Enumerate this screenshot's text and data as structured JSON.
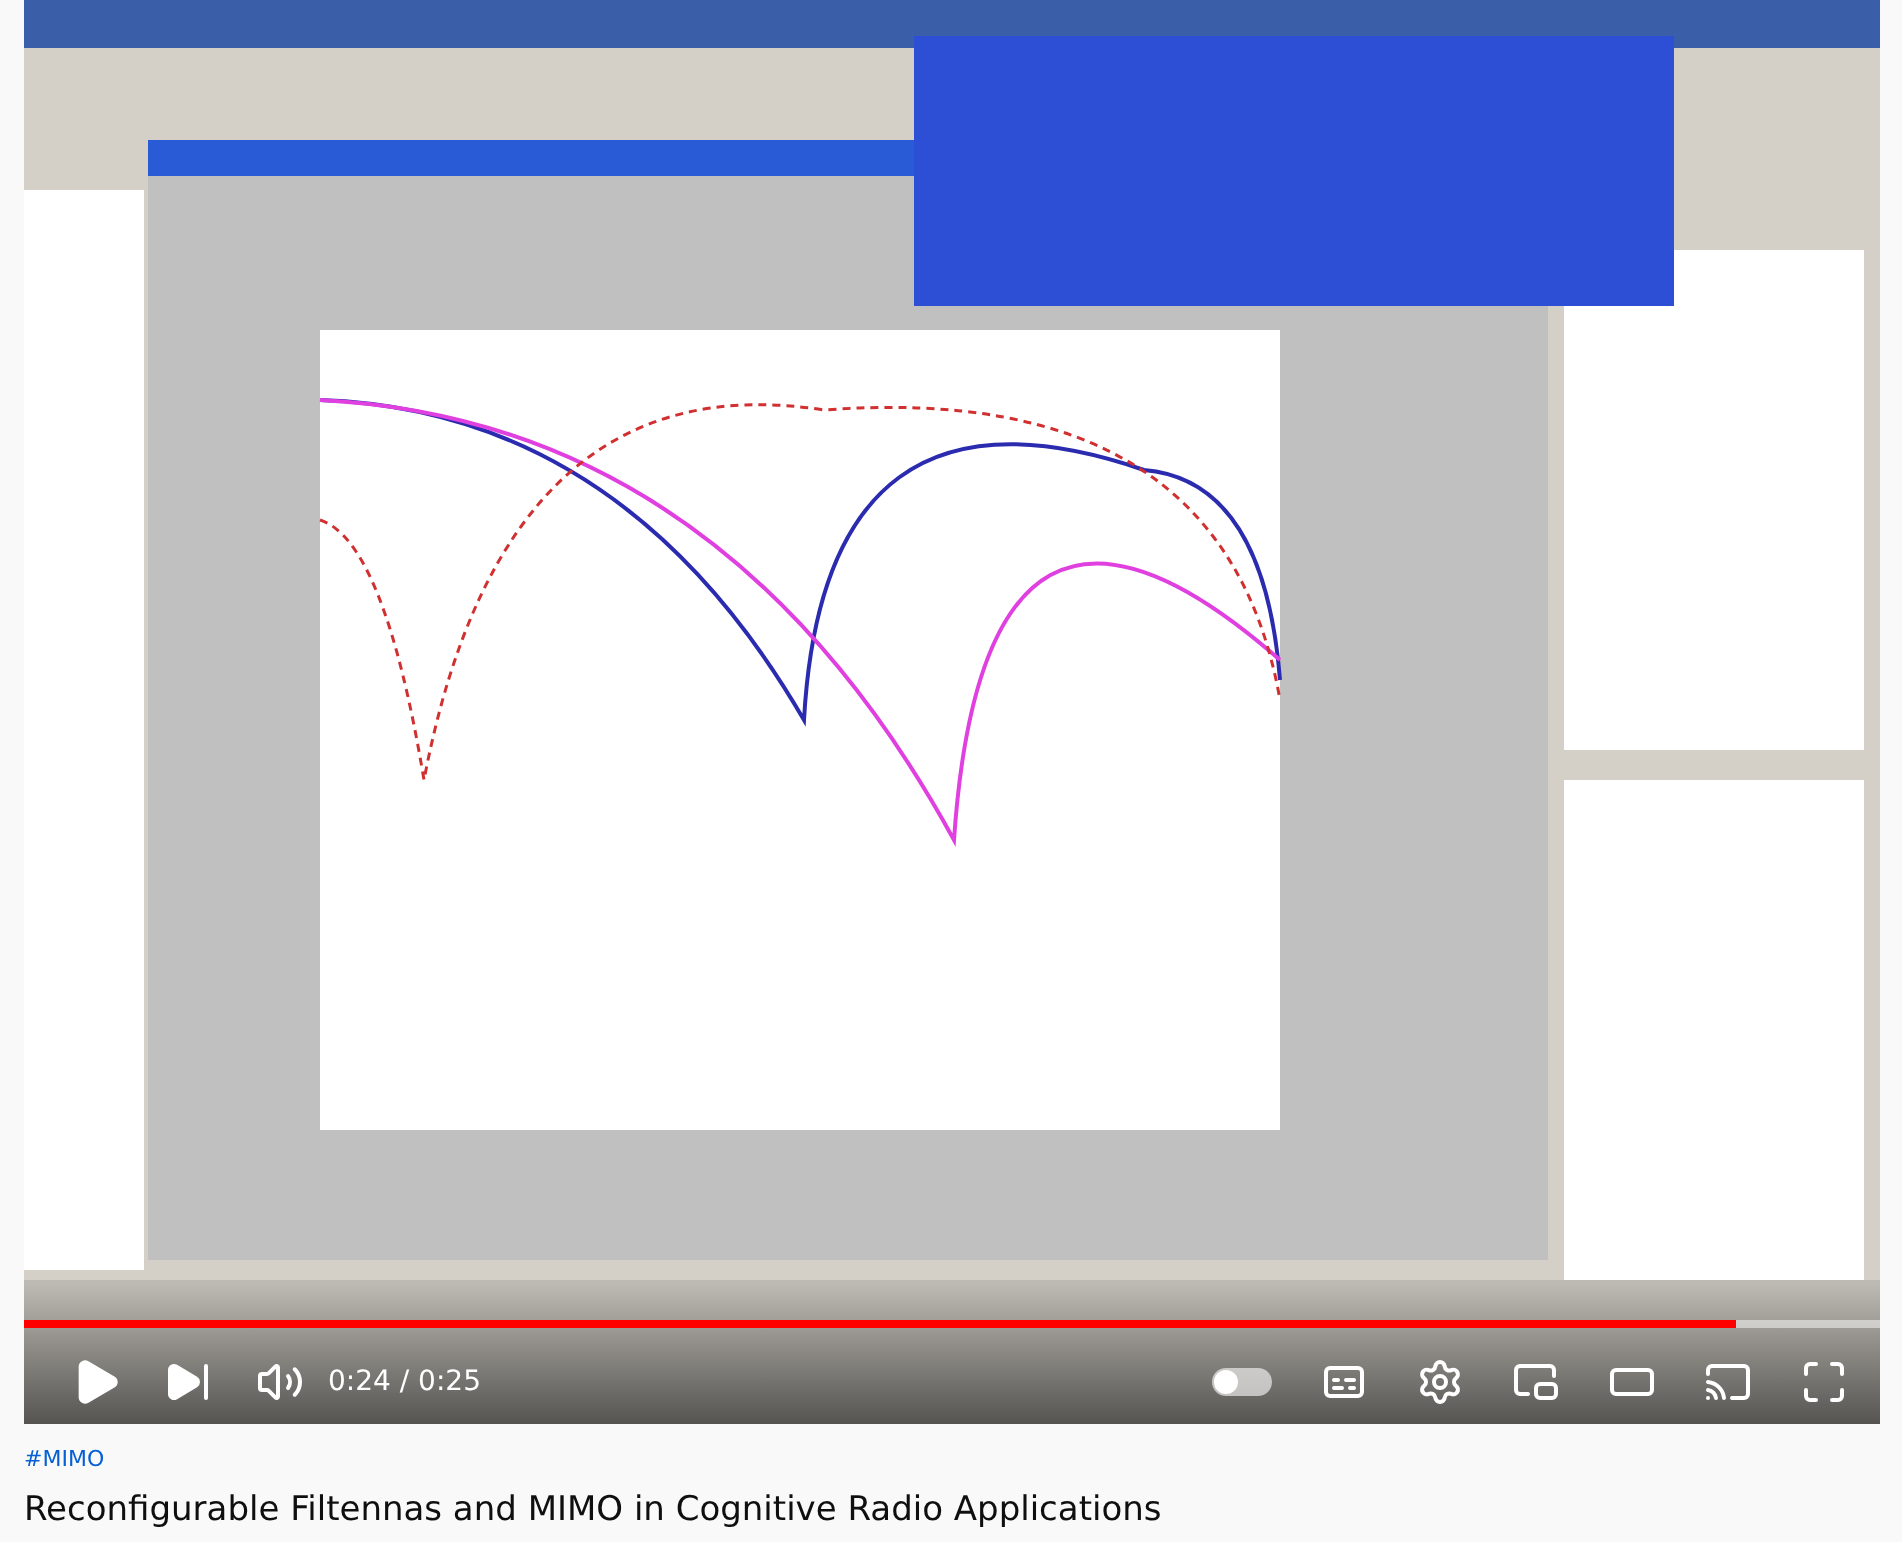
{
  "video": {
    "kind": "picture",
    "progress": {
      "level": 0.922
    },
    "time": "0:24 / 0:25"
  },
  "autoplay": {
    "on": false
  },
  "hashtag": "#MIMO",
  "title": "Reconfigurable Filtennas and MIMO in Cognitive Radio Applications"
}
